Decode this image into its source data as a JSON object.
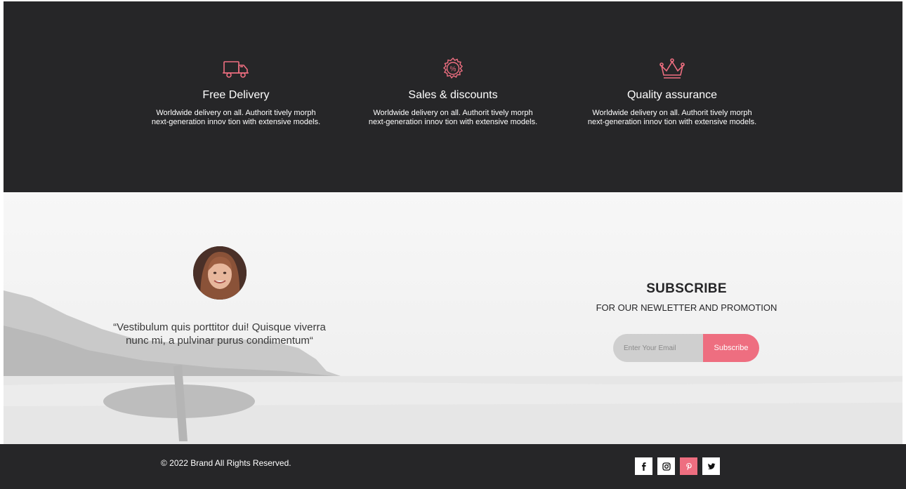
{
  "features": [
    {
      "icon": "delivery-truck-icon",
      "title": "Free Delivery",
      "text": "Worldwide delivery on all. Authorit tively morph\nnext-generation innov tion with extensive models."
    },
    {
      "icon": "discount-badge-icon",
      "title": "Sales & discounts",
      "text": "Worldwide delivery on all. Authorit tively morph\nnext-generation innov tion with extensive models."
    },
    {
      "icon": "crown-icon",
      "title": "Quality assurance",
      "text": "Worldwide delivery on all. Authorit tively morph\nnext-generation innov tion with extensive models."
    }
  ],
  "testimonial": {
    "quote": "“Vestibulum quis porttitor dui! Quisque viverra nunc mi, a pulvinar purus condimentum“"
  },
  "subscribe": {
    "title": "SUBSCRIBE",
    "subtitle": "FOR OUR NEWLETTER AND PROMOTION",
    "email_placeholder": "Enter Your Email",
    "button_label": "Subscribe"
  },
  "footer": {
    "copyright": "© 2022 Brand All Rights Reserved.",
    "social": [
      "facebook-icon",
      "instagram-icon",
      "pinterest-icon",
      "twitter-icon"
    ]
  },
  "colors": {
    "dark": "#262628",
    "accent": "#ee6e80",
    "light_bg": "#f4f4f4"
  }
}
